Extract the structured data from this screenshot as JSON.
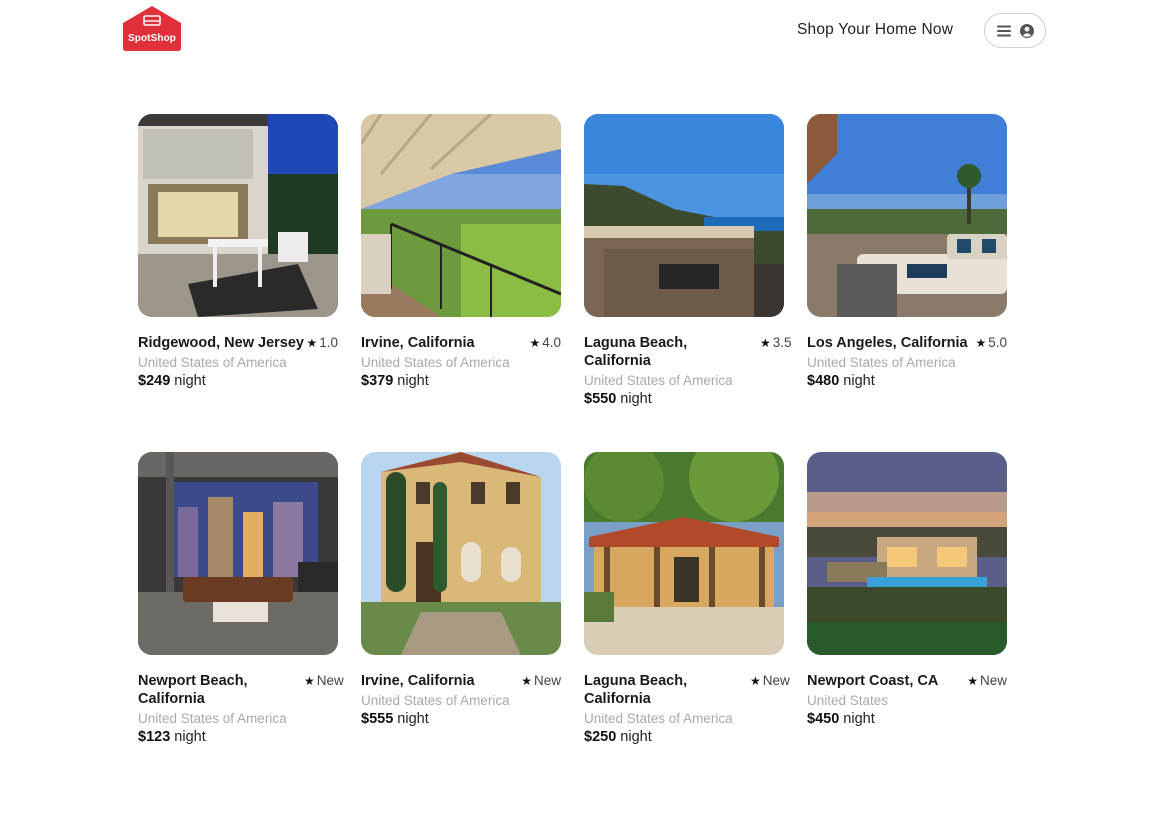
{
  "header": {
    "logo_text": "SpotShop",
    "brand_color": "#e0313a",
    "nav_link": "Shop Your Home Now",
    "menu_icon": "hamburger-icon",
    "user_icon": "user-circle-icon"
  },
  "listings": [
    {
      "city": "Ridgewood, New Jersey",
      "rating": "1.0",
      "country": "United States of America",
      "price": "$249",
      "unit": "night"
    },
    {
      "city": "Irvine, California",
      "rating": "4.0",
      "country": "United States of America",
      "price": "$379",
      "unit": "night"
    },
    {
      "city": "Laguna Beach, California",
      "rating": "3.5",
      "country": "United States of America",
      "price": "$550",
      "unit": "night"
    },
    {
      "city": "Los Angeles, California",
      "rating": "5.0",
      "country": "United States of America",
      "price": "$480",
      "unit": "night"
    },
    {
      "city": "Newport Beach, California",
      "rating": "New",
      "country": "United States of America",
      "price": "$123",
      "unit": "night"
    },
    {
      "city": "Irvine, California",
      "rating": "New",
      "country": "United States of America",
      "price": "$555",
      "unit": "night"
    },
    {
      "city": "Laguna Beach, California",
      "rating": "New",
      "country": "United States of America",
      "price": "$250",
      "unit": "night"
    },
    {
      "city": "Newport Coast, CA",
      "rating": "New",
      "country": "United States",
      "price": "$450",
      "unit": "night"
    }
  ]
}
